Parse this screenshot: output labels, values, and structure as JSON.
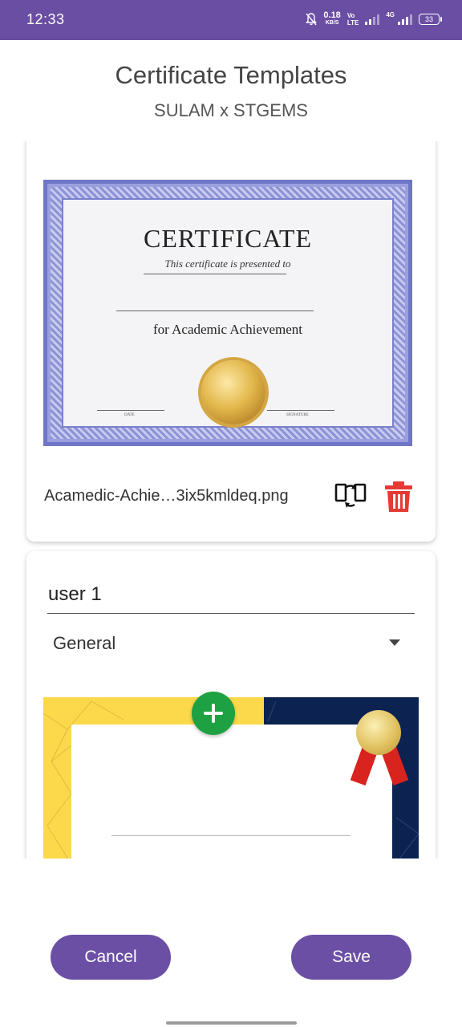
{
  "status_bar": {
    "time": "12:33",
    "net_speed": "0.18",
    "net_unit": "KB/S",
    "volte_top": "Vo",
    "volte_bottom": "LTE",
    "network_type": "4G",
    "battery": "33",
    "background_color": "#6a4ea3"
  },
  "header": {
    "title": "Certificate Templates",
    "subtitle": "SULAM x STGEMS"
  },
  "templates": [
    {
      "image": {
        "heading": "CERTIFICATE",
        "subheading": "This certificate is presented to",
        "achievement": "for Academic Achievement",
        "date_label": "DATE",
        "signature_label": "SIGNATURE"
      },
      "file_name": "Acamedic-Achie…3ix5kmldeq.png",
      "icons": {
        "swap": "swap-icon",
        "delete": "trash-icon"
      }
    },
    {
      "name_value": "user 1",
      "category": "General",
      "image": {
        "style": "yellow-navy certificate with gold medal"
      }
    }
  ],
  "add_button_icon": "plus-icon",
  "buttons": {
    "cancel": "Cancel",
    "save": "Save"
  },
  "colors": {
    "primary": "#6b4fa5",
    "add": "#1ea142",
    "delete": "#e53935"
  }
}
